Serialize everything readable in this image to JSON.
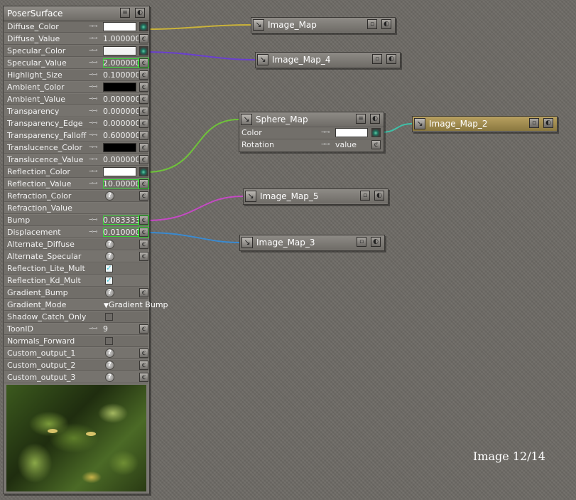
{
  "panel": {
    "title": "PoserSurface",
    "params": [
      {
        "label": "Diffuse_Color",
        "kind": "color",
        "color": "#ffffff",
        "linked": true
      },
      {
        "label": "Diffuse_Value",
        "kind": "value",
        "value": "1.000000"
      },
      {
        "label": "Specular_Color",
        "kind": "color",
        "color": "#f2f2f2",
        "linked": true
      },
      {
        "label": "Specular_Value",
        "kind": "value",
        "value": "2.000000",
        "highlighted": true
      },
      {
        "label": "Highlight_Size",
        "kind": "value",
        "value": "0.100000"
      },
      {
        "label": "Ambient_Color",
        "kind": "color",
        "color": "#000000"
      },
      {
        "label": "Ambient_Value",
        "kind": "value",
        "value": "0.000000"
      },
      {
        "label": "Transparency",
        "kind": "value",
        "value": "0.000000"
      },
      {
        "label": "Transparency_Edge",
        "kind": "value",
        "value": "0.000000"
      },
      {
        "label": "Transparency_Falloff",
        "kind": "value",
        "value": "0.600000"
      },
      {
        "label": "Translucence_Color",
        "kind": "color",
        "color": "#000000"
      },
      {
        "label": "Translucence_Value",
        "kind": "value",
        "value": "0.000000"
      },
      {
        "label": "Reflection_Color",
        "kind": "color",
        "color": "#ffffff",
        "linked": true
      },
      {
        "label": "Reflection_Value",
        "kind": "value",
        "value": "10.000000",
        "highlighted": true
      },
      {
        "label": "Refraction_Color",
        "kind": "help"
      },
      {
        "label": "Refraction_Value",
        "kind": "none"
      },
      {
        "label": "Bump",
        "kind": "value",
        "value": "0.083333",
        "highlighted": true
      },
      {
        "label": "Displacement",
        "kind": "value",
        "value": "0.010000",
        "highlighted": true
      },
      {
        "label": "Alternate_Diffuse",
        "kind": "help"
      },
      {
        "label": "Alternate_Specular",
        "kind": "help"
      },
      {
        "label": "Reflection_Lite_Mult",
        "kind": "checkbox",
        "checked": true
      },
      {
        "label": "Reflection_Kd_Mult",
        "kind": "checkbox",
        "checked": true
      },
      {
        "label": "Gradient_Bump",
        "kind": "help",
        "connector": true
      },
      {
        "label": "Gradient_Mode",
        "kind": "dropdown",
        "value": "Gradient Bump"
      },
      {
        "label": "Shadow_Catch_Only",
        "kind": "checkbox",
        "checked": false
      },
      {
        "label": "ToonID",
        "kind": "value",
        "value": "9"
      },
      {
        "label": "Normals_Forward",
        "kind": "checkbox",
        "checked": false
      },
      {
        "label": "Custom_output_1",
        "kind": "help"
      },
      {
        "label": "Custom_output_2",
        "kind": "help"
      },
      {
        "label": "Custom_output_3",
        "kind": "help"
      }
    ]
  },
  "nodes": [
    {
      "title": "Image_Map"
    },
    {
      "title": "Image_Map_4"
    },
    {
      "title": "Sphere_Map",
      "rows": [
        {
          "label": "Color",
          "kind": "color"
        },
        {
          "label": "Rotation",
          "kind": "value",
          "value": "value"
        }
      ]
    },
    {
      "title": "Image_Map_2"
    },
    {
      "title": "Image_Map_5"
    },
    {
      "title": "Image_Map_3"
    }
  ],
  "wire_colors": {
    "diffuse": "#c9b23a",
    "specular": "#6a3fd0",
    "reflection": "#6fc23a",
    "sphere_out": "#3fc0a8",
    "bump": "#c44ac4",
    "displacement": "#3a8ad0"
  },
  "caption": "Image 12/14"
}
